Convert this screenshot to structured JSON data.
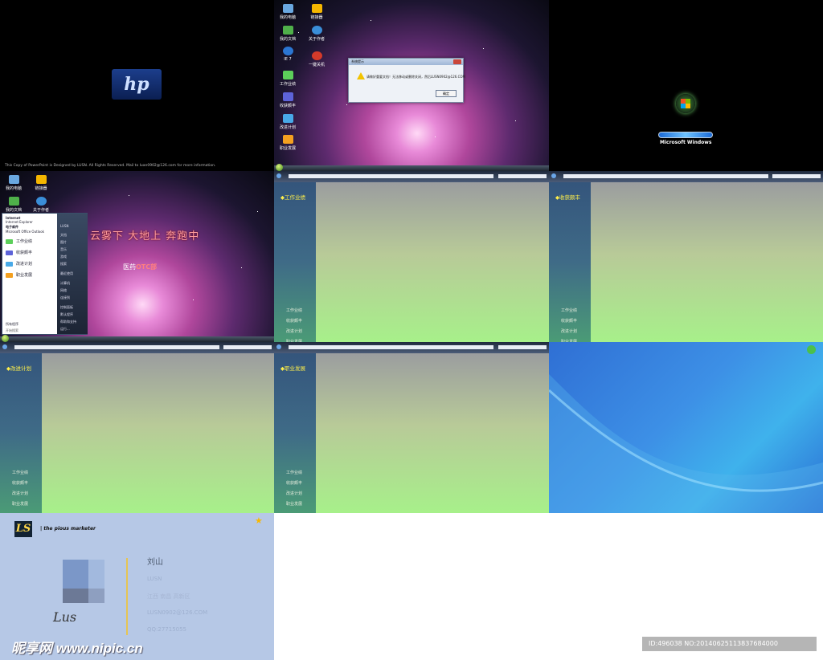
{
  "slide1": {
    "logo_text": "hp",
    "footer": "This Copy of PowerPoint is Designed by LUSN. All Rights Reserved. Mail to luan0902@126.com for more information."
  },
  "slide2": {
    "icons": [
      "我的电脑",
      "链接器",
      "我的文档",
      "关于作者",
      "IE 7",
      "一键关机",
      "工作业绩",
      "收获颇丰",
      "改进计划",
      "职业发展"
    ],
    "dialog": {
      "title": "系统提示",
      "message": "请做好重要文档！无法移动或删除关闭，然后LUSN0902@126.COM",
      "ok": "确定"
    }
  },
  "slide3": {
    "brand": "Microsoft Windows"
  },
  "slide4": {
    "slogan": "云雾下 大地上 奔跑中",
    "dept_prefix": "医药",
    "dept_highlight": "OTC部",
    "user": "LUSN",
    "menu_items": [
      "工作业绩",
      "收获颇丰",
      "改进计划",
      "职业发展"
    ],
    "pinned": [
      {
        "title": "Internet",
        "sub": "Internet Explorer"
      },
      {
        "title": "电子邮件",
        "sub": "Microsoft Office Outlook"
      }
    ],
    "all_programs": "所有程序",
    "search_placeholder": "开始搜索",
    "right_items": [
      "文档",
      "图片",
      "音乐",
      "游戏",
      "搜索",
      "最近使用",
      "计算机",
      "网络",
      "连接到",
      "控制面板",
      "默认程序",
      "帮助和支持",
      "运行..."
    ],
    "desktop_icons": [
      "我的电脑",
      "链接器",
      "我的文档",
      "关于作者"
    ]
  },
  "sections": [
    {
      "title": "◆工作业绩"
    },
    {
      "title": "◆收获颇丰"
    },
    {
      "title": "◆改进计划"
    },
    {
      "title": "◆职业发展"
    }
  ],
  "nav_links": [
    "工作业绩",
    "收获颇丰",
    "改进计划",
    "职业发展"
  ],
  "card": {
    "logo": "LS",
    "tagline": "the pious marketer",
    "name": "刘山",
    "id": "LUSN",
    "address": "江西  南昌  高新区",
    "email": "LUSN0902@126.COM",
    "qq": "QQ:27715055",
    "signature": "Lus"
  },
  "watermark": "昵享网 www.nipic.cn",
  "image_id": "ID:496038 NO:20140625113837684000",
  "colors": {
    "section_title": "#ffef4a",
    "accent": "#e6c552"
  }
}
